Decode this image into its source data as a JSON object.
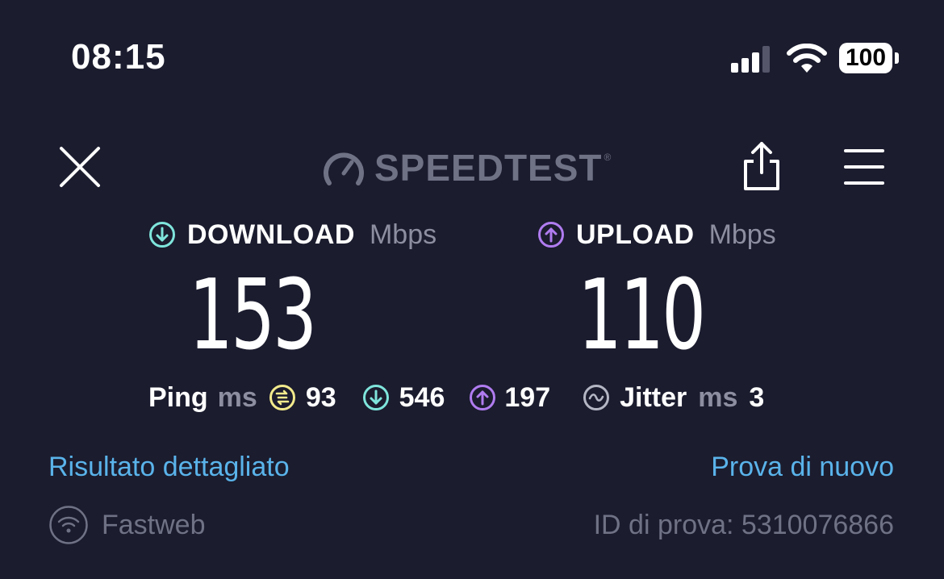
{
  "status_bar": {
    "time": "08:15",
    "battery": "100",
    "icons": [
      "signal-icon",
      "wifi-icon",
      "battery-icon"
    ]
  },
  "header": {
    "logo_text": "SPEEDTEST",
    "logo_tm": "®",
    "icons": [
      "close-icon",
      "speedometer-icon",
      "share-icon",
      "menu-icon"
    ]
  },
  "download": {
    "label": "DOWNLOAD",
    "unit": "Mbps",
    "value": "153",
    "icon": "arrow-down-circle-icon",
    "color": "#7fe5dc"
  },
  "upload": {
    "label": "UPLOAD",
    "unit": "Mbps",
    "value": "110",
    "icon": "arrow-up-circle-icon",
    "color": "#b07cf0"
  },
  "ping": {
    "label": "Ping",
    "unit": "ms",
    "idle": "93",
    "download": "546",
    "upload": "197",
    "idle_color": "#f2ea8c"
  },
  "jitter": {
    "label": "Jitter",
    "unit": "ms",
    "value": "3"
  },
  "links": {
    "detail": "Risultato dettagliato",
    "retry": "Prova di nuovo",
    "color": "#5ab3ea"
  },
  "footer": {
    "isp": "Fastweb",
    "test_id": "ID di prova: 5310076866"
  }
}
